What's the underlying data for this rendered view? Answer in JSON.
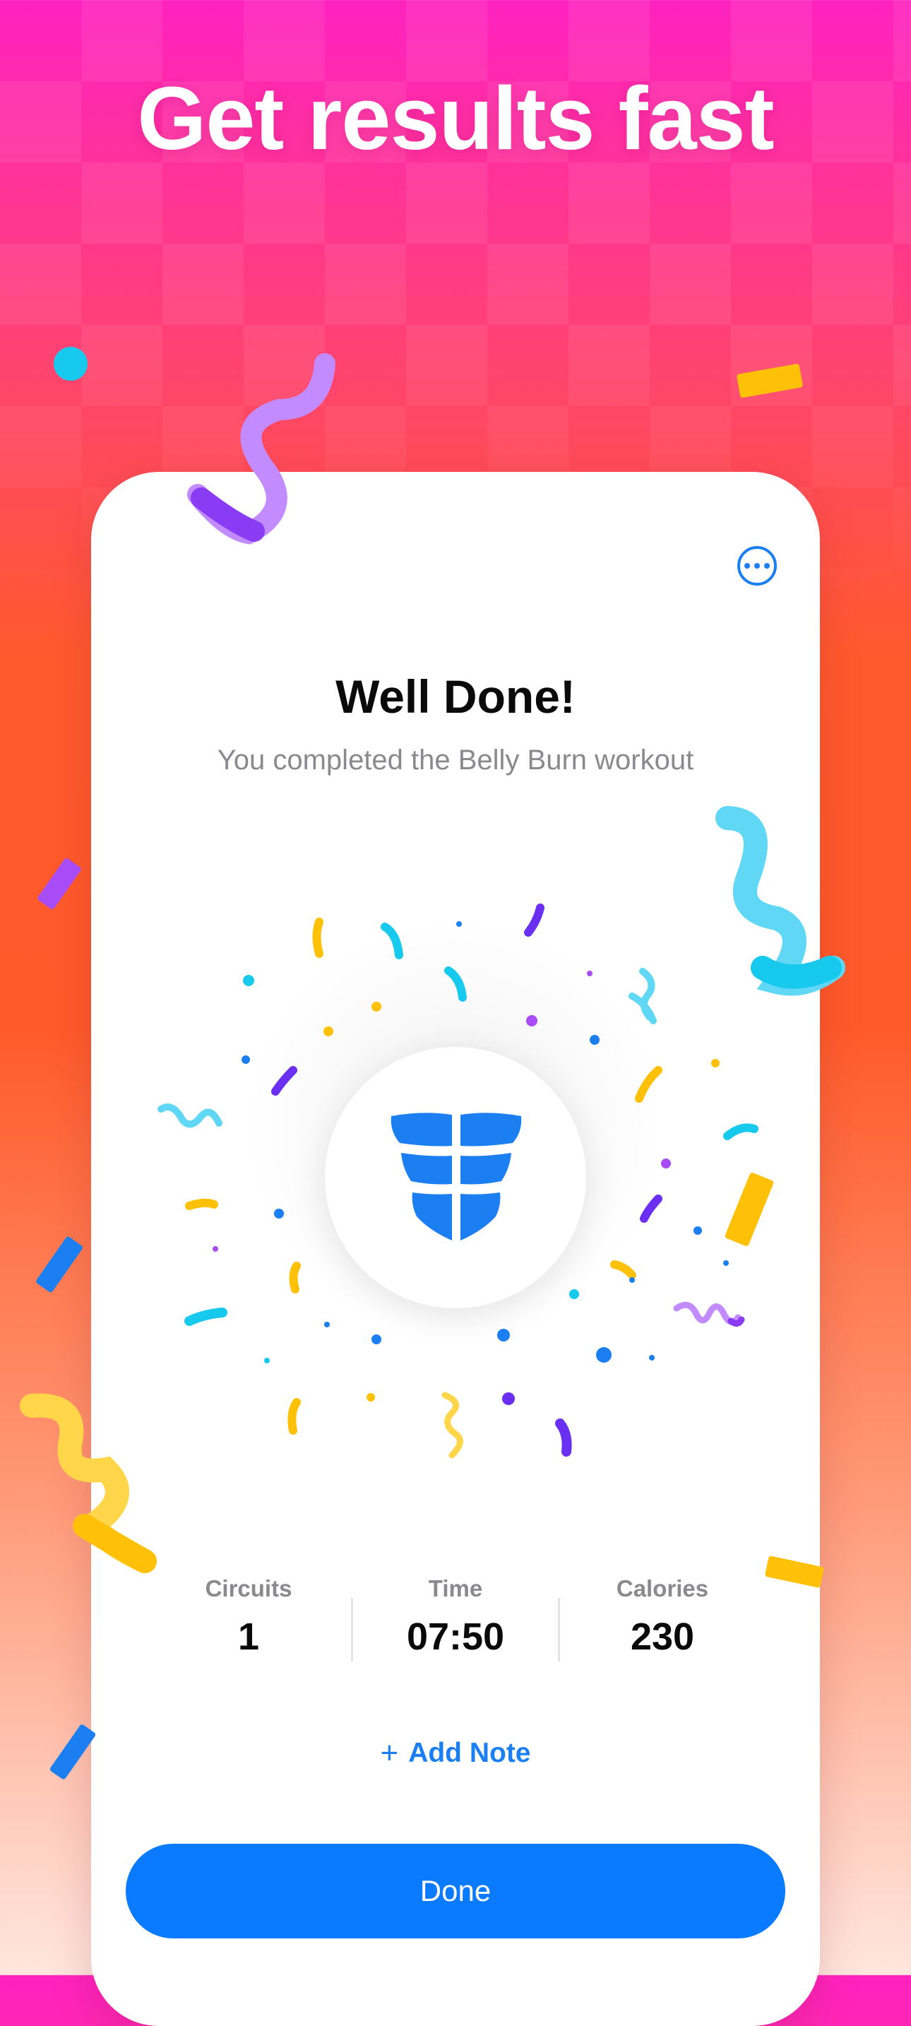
{
  "headline": "Get results fast",
  "card": {
    "title": "Well Done!",
    "subtitle": "You completed the Belly Burn workout",
    "more_icon": "ellipsis-circle-icon",
    "badge_icon": "abs-icon"
  },
  "stats": [
    {
      "label": "Circuits",
      "value": "1"
    },
    {
      "label": "Time",
      "value": "07:50"
    },
    {
      "label": "Calories",
      "value": "230"
    }
  ],
  "add_note": {
    "icon": "plus-icon",
    "label": "Add Note"
  },
  "done_button": {
    "label": "Done"
  },
  "colors": {
    "accent": "#0A7BFF",
    "confetti_yellow": "#FFC107",
    "confetti_cyan": "#18C9EE",
    "confetti_purple": "#8A3CF5",
    "confetti_blue": "#1B7FF2"
  }
}
